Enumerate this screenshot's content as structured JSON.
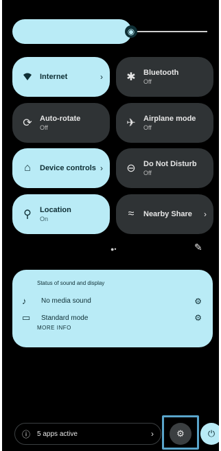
{
  "brightness": {
    "level_percent": 61,
    "icon": "brightness-icon"
  },
  "tiles": [
    {
      "title": "Internet",
      "subtitle": "",
      "state": "on",
      "icon": "wifi-icon",
      "has_chevron": true
    },
    {
      "title": "Bluetooth",
      "subtitle": "Off",
      "state": "off",
      "icon": "bluetooth-icon",
      "has_chevron": false
    },
    {
      "title": "Auto-rotate",
      "subtitle": "Off",
      "state": "off",
      "icon": "rotate-icon",
      "has_chevron": false
    },
    {
      "title": "Airplane mode",
      "subtitle": "Off",
      "state": "off",
      "icon": "airplane-icon",
      "has_chevron": false
    },
    {
      "title": "Device controls",
      "subtitle": "",
      "state": "on",
      "icon": "home-icon",
      "has_chevron": true
    },
    {
      "title": "Do Not Disturb",
      "subtitle": "Off",
      "state": "off",
      "icon": "dnd-icon",
      "has_chevron": false
    },
    {
      "title": "Location",
      "subtitle": "On",
      "state": "on",
      "icon": "location-icon",
      "has_chevron": false
    },
    {
      "title": "Nearby Share",
      "subtitle": "",
      "state": "off",
      "icon": "nearby-share-icon",
      "has_chevron": true
    }
  ],
  "sound_card": {
    "header": "Status of sound and display",
    "rows": [
      {
        "label": "No media sound",
        "icon": "music-note-icon",
        "action_icon": "settings-icon"
      },
      {
        "label": "Standard mode",
        "icon": "display-icon",
        "action_icon": "settings-icon"
      }
    ],
    "more_info": "MORE INFO"
  },
  "footer": {
    "active_apps_label": "5 apps active",
    "icons": [
      "info-icon",
      "settings-icon",
      "power-icon"
    ]
  },
  "colors": {
    "panel_bg": "#000000",
    "tile_on": "#b9ebf6",
    "tile_off": "#2f3335",
    "highlight": "#59a4ca"
  }
}
